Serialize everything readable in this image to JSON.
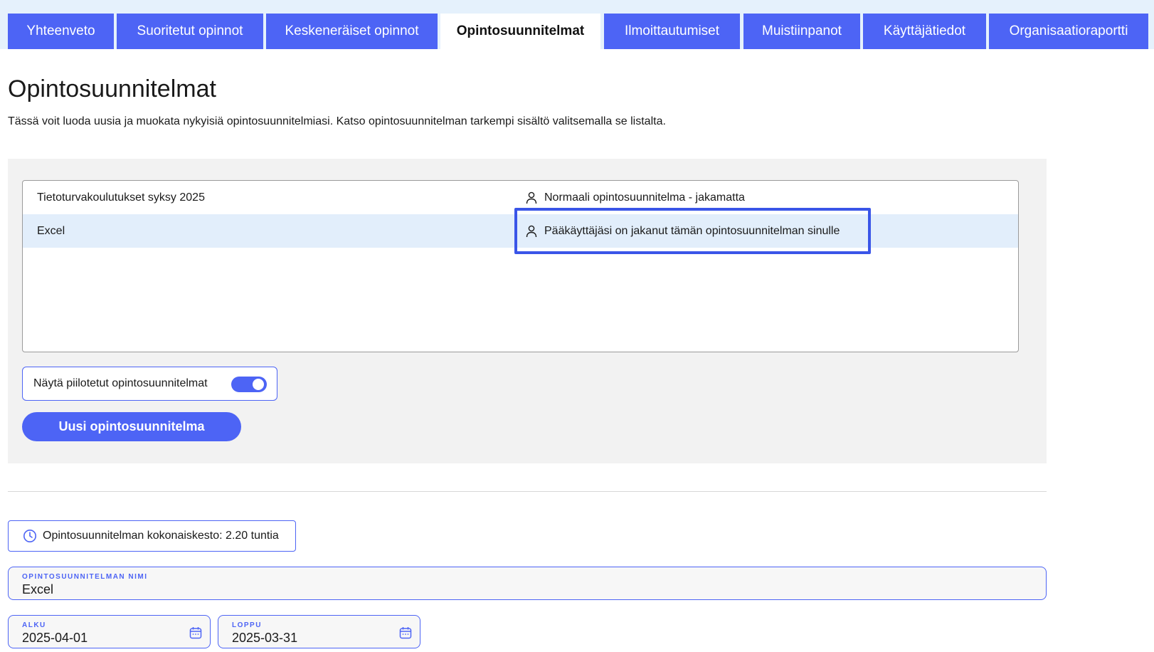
{
  "tabs": [
    {
      "label": "Yhteenveto",
      "active": false
    },
    {
      "label": "Suoritetut opinnot",
      "active": false
    },
    {
      "label": "Keskeneräiset opinnot",
      "active": false
    },
    {
      "label": "Opintosuunnitelmat",
      "active": true
    },
    {
      "label": "Ilmoittautumiset",
      "active": false
    },
    {
      "label": "Muistiinpanot",
      "active": false
    },
    {
      "label": "Käyttäjätiedot",
      "active": false
    },
    {
      "label": "Organisaatioraportti",
      "active": false
    }
  ],
  "page": {
    "title": "Opintosuunnitelmat",
    "description": "Tässä voit luoda uusia ja muokata nykyisiä opintosuunnitelmiasi. Katso opintosuunnitelman tarkempi sisältö valitsemalla se listalta."
  },
  "plans": [
    {
      "name": "Tietoturvakoulutukset syksy 2025",
      "status": "Normaali opintosuunnitelma  -  jakamatta",
      "selected": false
    },
    {
      "name": "Excel",
      "status": "Pääkäyttäjäsi on jakanut tämän opintosuunnitelman sinulle",
      "selected": true
    }
  ],
  "toggle": {
    "label": "Näytä piilotetut opintosuunnitelmat",
    "on": true
  },
  "new_button": {
    "label": "Uusi opintosuunnitelma"
  },
  "duration": {
    "text": "Opintosuunnitelman kokonaiskesto: 2.20 tuntia"
  },
  "form": {
    "name_label": "OPINTOSUUNNITELMAN NIMI",
    "name_value": "Excel",
    "start_label": "ALKU",
    "start_value": "2025-04-01",
    "end_label": "LOPPU",
    "end_value": "2025-03-31"
  },
  "colors": {
    "accent": "#4d64f5",
    "topbar_bg": "#e5f1fc",
    "selected_row": "#e2eefb",
    "focus_ring": "#3a55e8",
    "panel_bg": "#f2f2f2"
  },
  "icons": {
    "person": "person-icon",
    "clock": "clock-icon",
    "calendar": "calendar-icon"
  }
}
